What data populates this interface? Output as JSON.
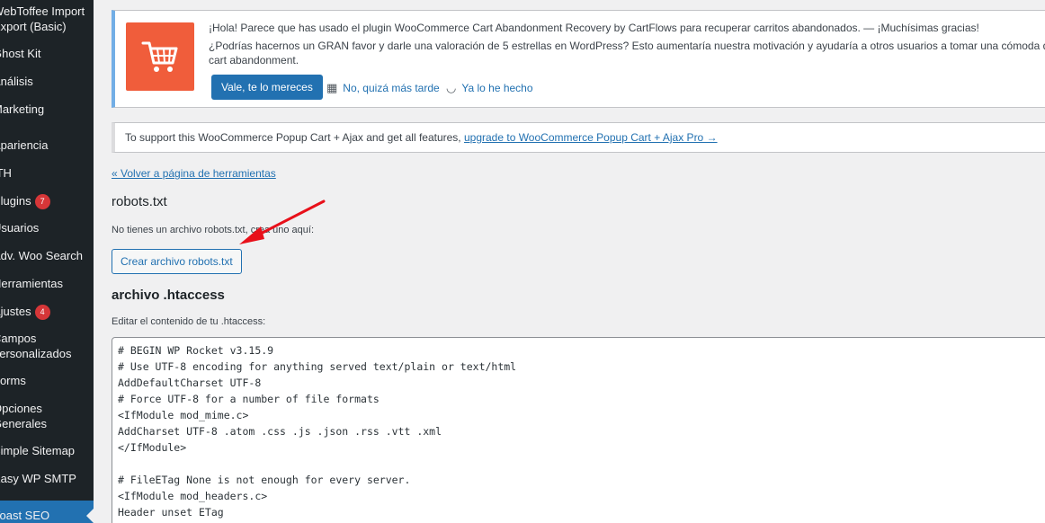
{
  "sidebar": {
    "items": [
      {
        "label": "WebToffee Import\nExport (Basic)"
      },
      {
        "label": "Ghost Kit"
      },
      {
        "label": "Análisis"
      },
      {
        "label": "Marketing"
      },
      {
        "label": "Apariencia"
      },
      {
        "label": "ITH"
      },
      {
        "label": "Plugins",
        "badge": "7"
      },
      {
        "label": "Usuarios"
      },
      {
        "label": "Adv. Woo Search"
      },
      {
        "label": "Herramientas"
      },
      {
        "label": "Ajustes",
        "badge": "4"
      },
      {
        "label": "Campos\npersonalizados"
      },
      {
        "label": "Forms"
      },
      {
        "label": "Opciones\nGenerales"
      },
      {
        "label": "Simple Sitemap"
      },
      {
        "label": "Easy WP SMTP"
      },
      {
        "label": "Yoast SEO"
      }
    ]
  },
  "cart_notice": {
    "line1": "¡Hola! Parece que has usado el plugin WooCommerce Cart Abandonment Recovery by CartFlows para recuperar carritos abandonados. — ¡Muchísimas gracias!",
    "line2": "¿Podrías hacernos un GRAN favor y darle una valoración de 5 estrellas en WordPress? Esto aumentaría nuestra motivación y ayudaría a otros usuarios a tomar una cómoda decisión a",
    "line3": "cart abandonment.",
    "rate_button": "Vale, te lo mereces",
    "later_link": "No, quizá más tarde",
    "done_link": "Ya lo he hecho"
  },
  "popup_notice": {
    "text": "To support this WooCommerce Popup Cart + Ajax and get all features, ",
    "link": "upgrade to WooCommerce Popup Cart + Ajax Pro →"
  },
  "back_link": "« Volver a página de herramientas",
  "robots": {
    "title": "robots.txt",
    "description": "No tienes un archivo robots.txt, crea uno aquí:",
    "button": "Crear archivo robots.txt"
  },
  "htaccess": {
    "title": "archivo .htaccess",
    "description": "Editar el contenido de tu .htaccess:",
    "content": "# BEGIN WP Rocket v3.15.9\n# Use UTF-8 encoding for anything served text/plain or text/html\nAddDefaultCharset UTF-8\n# Force UTF-8 for a number of file formats\n<IfModule mod_mime.c>\nAddCharset UTF-8 .atom .css .js .json .rss .vtt .xml\n</IfModule>\n\n# FileETag None is not enough for every server.\n<IfModule mod_headers.c>\nHeader unset ETag\n</IfModule>"
  },
  "colors": {
    "sidebar_bg": "#1d2327",
    "accent": "#2271b1",
    "cart_logo": "#f05d3b",
    "annotation_arrow": "#e8101a",
    "badge": "#d63638"
  }
}
